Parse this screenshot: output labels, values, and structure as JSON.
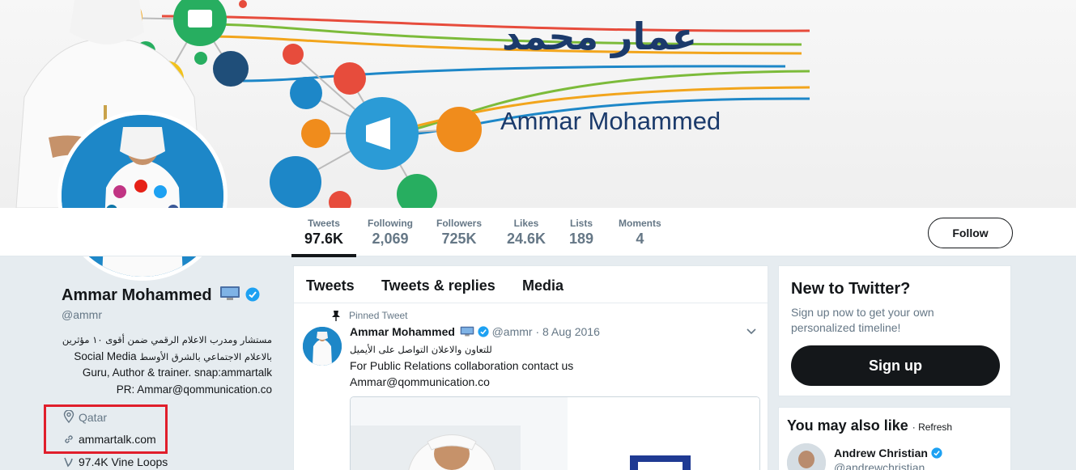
{
  "banner": {
    "name_ar": "عمار محمد",
    "name_en": "Ammar Mohammed"
  },
  "nav": {
    "stats": [
      {
        "label": "Tweets",
        "value": "97.6K"
      },
      {
        "label": "Following",
        "value": "2,069"
      },
      {
        "label": "Followers",
        "value": "725K"
      },
      {
        "label": "Likes",
        "value": "24.6K"
      },
      {
        "label": "Lists",
        "value": "189"
      },
      {
        "label": "Moments",
        "value": "4"
      }
    ],
    "follow_label": "Follow"
  },
  "profile": {
    "name": "Ammar Mohammed",
    "handle": "@ammr",
    "bio_line1": "مستشار ومدرب الاعلام الرقمي ضمن أقوى ١٠ مؤثرين",
    "bio_line2_ar": "بالاعلام الاجتماعي بالشرق الأوسط",
    "bio_line2_en": "Social Media",
    "bio_line3": "Guru, Author & trainer. snap:ammartalk",
    "bio_line4": "PR: Ammar@qommunication.co",
    "location": "Qatar",
    "website": "ammartalk.com",
    "vine_loops": "97.4K Vine Loops"
  },
  "timeline": {
    "tabs": [
      "Tweets",
      "Tweets & replies",
      "Media"
    ],
    "pinned_label": "Pinned Tweet",
    "tweet": {
      "author": "Ammar Mohammed",
      "handle": "@ammr",
      "date": "· 8 Aug 2016",
      "line_ar": "للتعاون والاعلان التواصل على الأيميل",
      "line_en": "For Public Relations collaboration contact us",
      "line_email": "Ammar@qommunication.co"
    }
  },
  "signup": {
    "title": "New to Twitter?",
    "text": "Sign up now to get your own personalized timeline!",
    "button": "Sign up"
  },
  "wtf": {
    "title": "You may also like",
    "refresh": "· Refresh",
    "user_name": "Andrew Christian",
    "user_handle": "@andrewchristian"
  },
  "colors": {
    "accent": "#1da1f2",
    "highlight": "#e01e2b",
    "banner_text": "#1b3a6b"
  }
}
